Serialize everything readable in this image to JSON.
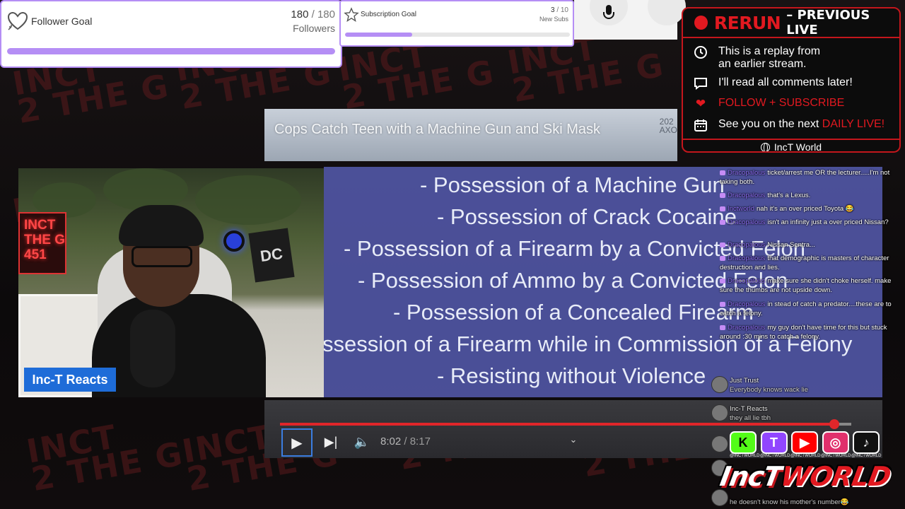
{
  "follower_goal": {
    "label": "Follower Goal",
    "current": "180",
    "separator": "/",
    "target": "180",
    "unit": "Followers",
    "progress": 1.0
  },
  "subscription_goal": {
    "label": "Subscription Goal",
    "current": "3",
    "separator": "/",
    "target": "10",
    "unit": "New Subs",
    "progress": 0.3
  },
  "background": {
    "brand_text": "INCT\n2 THE G"
  },
  "video": {
    "title": "Cops Catch Teen with a Machine Gun and Ski Mask",
    "corner_text": "202\nAXO",
    "charges": [
      "- Possession of a Machine Gun",
      "- Possession of Crack Cocaine",
      "- Possession of a Firearm by a Convicted Felon",
      "- Possession of Ammo by a Convicted Felon",
      "- Possession of a Concealed Firearm",
      "ssession of a Firearm while in Commission of a Felony",
      "- Resisting without Violence"
    ],
    "current_time": "8:02",
    "time_sep": " / ",
    "duration": "8:17",
    "progress": 0.97
  },
  "webcam": {
    "name_tag": "Inc-T Reacts",
    "sign_text": "INCT\nTHE G\n451"
  },
  "rerun_panel": {
    "title": "RERUN",
    "subtitle": "– PREVIOUS LIVE",
    "line1": "This is a replay from",
    "line1b": "an earlier stream.",
    "line2": "I'll read all comments later!",
    "line3": "FOLLOW + SUBSCRIBE",
    "line4_prefix": "See you on the next ",
    "line4_highlight": "DAILY LIVE!",
    "footer": "IncT World",
    "accent": "#e11920"
  },
  "chat": [
    {
      "user": "Dracopalous",
      "text": "ticket/arrest me OR the lecturer.....I'm not taking both."
    },
    {
      "user": "Dracopalous",
      "text": "that's a Lexus."
    },
    {
      "user": "Inctworld",
      "text": "nah it's an over priced Toyota 😂"
    },
    {
      "user": "Dracopalous",
      "text": "isn't an infinity just a over priced Nissan?"
    },
    {
      "user": "Dracopalous",
      "text": "Nissan Sentra..."
    },
    {
      "user": "Dracopalous",
      "text": "that demographic is masters of character destruction and lies."
    },
    {
      "user": "Dracopalous",
      "text": "make sure she didn't choke herself. make sure the thumbs are not upside down."
    },
    {
      "user": "Dracopalous",
      "text": "in stead of catch a predator....these are to catch a felony."
    },
    {
      "user": "Dracopalous",
      "text": "my guy don't have time for this but stuck around :30 mins to catch a felony."
    },
    {
      "user": "Just Trust",
      "text": "Everybody knows wack lie"
    },
    {
      "user": "Inc-T Reacts",
      "text": "they all lie tbh"
    },
    {
      "user": "",
      "text": "he doesn't know his mother's number😂"
    }
  ],
  "socials": [
    {
      "name": "kick",
      "glyph": "K",
      "handle": "@INCTWORLD",
      "color": "#53fc18"
    },
    {
      "name": "twitch",
      "glyph": "T",
      "handle": "@INCTWORLD",
      "color": "#9146ff"
    },
    {
      "name": "youtube",
      "glyph": "▶",
      "handle": "@INCTWORLD",
      "color": "#ff0000"
    },
    {
      "name": "instagram",
      "glyph": "◎",
      "handle": "@INCTWORLD",
      "color": "#e1306c"
    },
    {
      "name": "tiktok",
      "glyph": "♪",
      "handle": "@INCTWORLD",
      "color": "#111111"
    }
  ],
  "logo": {
    "part1": "IncT",
    "part2": "WORLD"
  }
}
